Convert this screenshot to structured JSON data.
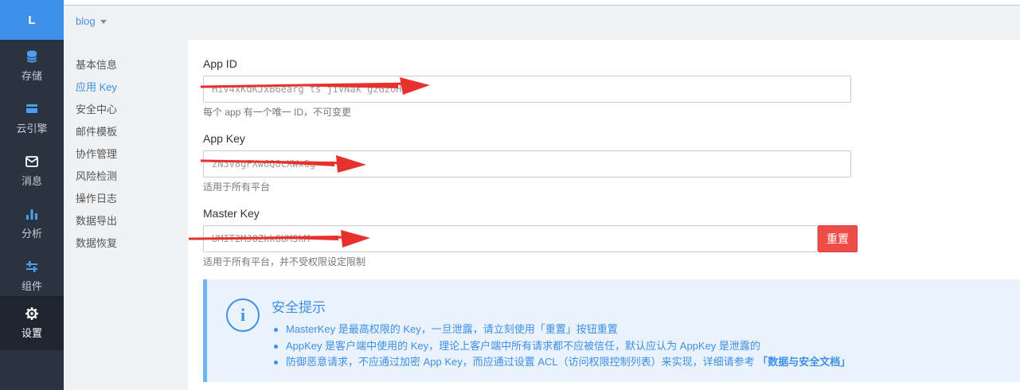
{
  "app": {
    "logo_letter": "L",
    "name": "blog"
  },
  "rail": {
    "items": [
      {
        "label": "存储",
        "icon": "database-icon"
      },
      {
        "label": "云引擎",
        "icon": "card-icon"
      },
      {
        "label": "消息",
        "icon": "mail-icon"
      },
      {
        "label": "分析",
        "icon": "bar-chart-icon"
      },
      {
        "label": "组件",
        "icon": "sliders-icon"
      },
      {
        "label": "设置",
        "icon": "gear-icon",
        "active": true
      }
    ]
  },
  "submenu": {
    "items": [
      "基本信息",
      "应用 Key",
      "安全中心",
      "邮件模板",
      "协作管理",
      "风险检测",
      "操作日志",
      "数据导出",
      "数据恢复"
    ],
    "active_index": 1
  },
  "fields": {
    "app_id": {
      "label": "App ID",
      "value": "HiV4xKdKJxB6earg ts jiVNak gzGzoHs",
      "help": "每个 app 有一个唯一 ID，不可变更"
    },
    "app_key": {
      "label": "App Key",
      "value": "zN3V8gFXw6Q8cXWx6g",
      "help": "适用于所有平台"
    },
    "master_key": {
      "label": "Master Key",
      "value": "UMIT2MJ8ZkkGUMSkM",
      "help": "适用于所有平台，并不受权限设定限制",
      "reset_label": "重置"
    }
  },
  "tip": {
    "title": "安全提示",
    "lines": [
      "MasterKey 是最高权限的 Key，一旦泄露，请立刻使用「重置」按钮重置",
      "AppKey 是客户端中使用的 Key，理论上客户端中所有请求都不应被信任，默认应认为 AppKey 是泄露的",
      "防御恶意请求，不应通过加密 App Key，而应通过设置 ACL（访问权限控制列表）来实现，详细请参考"
    ],
    "link": "「数据与安全文档」"
  },
  "colors": {
    "accent": "#3d8fe8",
    "danger": "#ee4c48",
    "rail": "#2b3240",
    "arrow": "#e8312c"
  }
}
